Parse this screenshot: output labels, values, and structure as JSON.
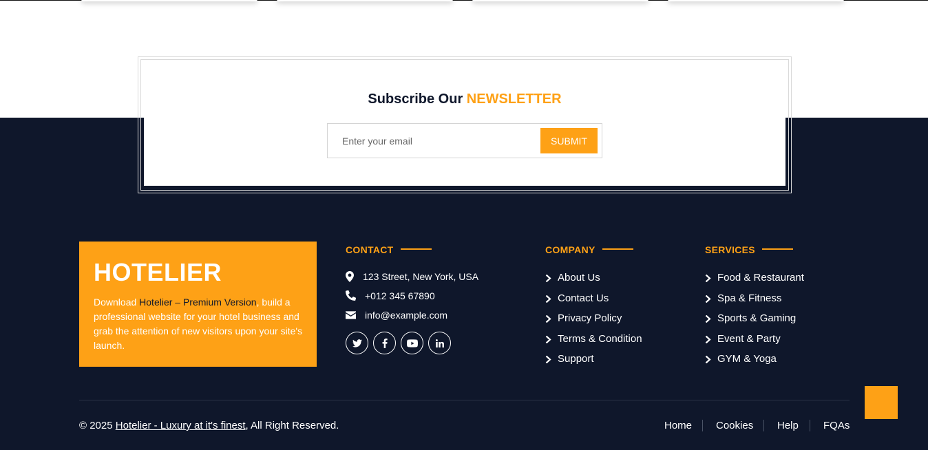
{
  "newsletter": {
    "title_prefix": "Subscribe Our",
    "title_accent": "NEWSLETTER",
    "email_placeholder": "Enter your email",
    "email_value": "",
    "submit_label": "SUBMIT"
  },
  "brand": {
    "name": "HOTELIER",
    "desc_before": "Download ",
    "desc_link": "Hotelier – Premium Version",
    "desc_after": ", build a professional website for your hotel business and grab the attention of new visitors upon your site's launch."
  },
  "contact": {
    "title": "CONTACT",
    "address": "123 Street, New York, USA",
    "phone": "+012 345 67890",
    "email": "info@example.com",
    "social": [
      "twitter-icon",
      "facebook-icon",
      "youtube-icon",
      "linkedin-icon"
    ]
  },
  "company": {
    "title": "COMPANY",
    "items": [
      "About Us",
      "Contact Us",
      "Privacy Policy",
      "Terms & Condition",
      "Support"
    ]
  },
  "services": {
    "title": "SERVICES",
    "items": [
      "Food & Restaurant",
      "Spa & Fitness",
      "Sports & Gaming",
      "Event & Party",
      "GYM & Yoga"
    ]
  },
  "footer": {
    "copyright_prefix": "© 2025",
    "copyright_link": "Hotelier - Luxury at it's finest",
    "copyright_suffix": ", All Right Reserved.",
    "links": [
      "Home",
      "Cookies",
      "Help",
      "FQAs"
    ]
  },
  "colors": {
    "accent": "#fea116",
    "dark": "#0f172b",
    "white": "#ffffff"
  }
}
